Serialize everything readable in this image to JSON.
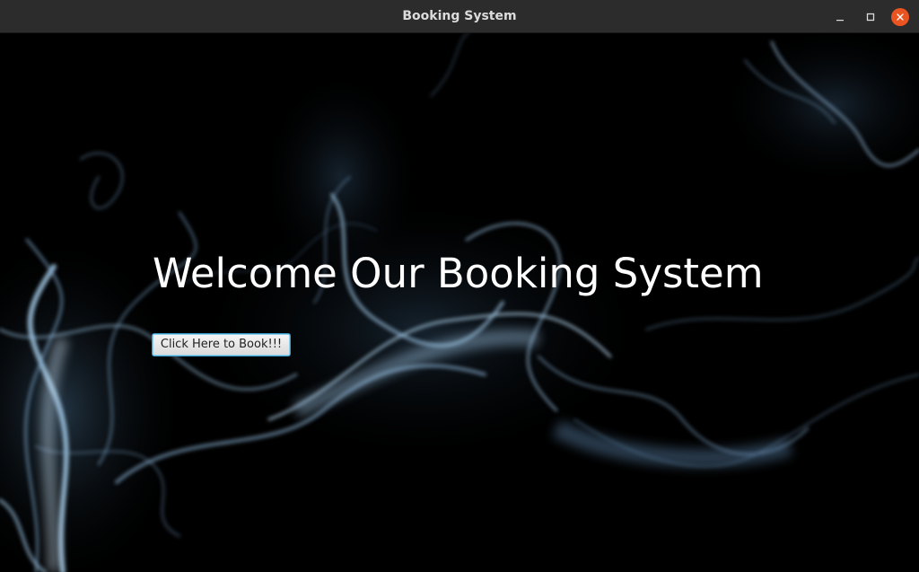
{
  "window": {
    "title": "Booking System",
    "minimize_icon": "minimize-icon",
    "maximize_icon": "maximize-icon",
    "close_icon": "close-icon",
    "close_color": "#e95420"
  },
  "main": {
    "heading": "Welcome Our Booking System",
    "book_button_label": "Click Here to Book!!!",
    "background": "smoke-image",
    "text_color": "#ffffff",
    "button_focus_color": "#3e9bc9"
  }
}
